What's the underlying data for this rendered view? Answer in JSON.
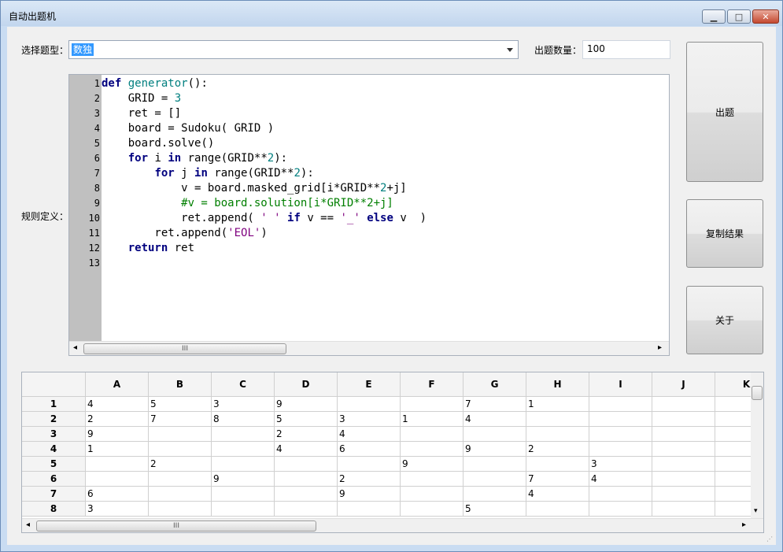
{
  "window": {
    "title": "自动出题机",
    "minimize": "▁",
    "maximize": "□",
    "close": "✕"
  },
  "labels": {
    "type": "选择题型：",
    "count": "出题数量：",
    "rules": "规则定义："
  },
  "type_select": {
    "value": "数独"
  },
  "count_input": {
    "value": "100"
  },
  "buttons": {
    "generate": "出题",
    "copy": "复制结果",
    "about": "关于"
  },
  "scroll": {
    "grip": "III",
    "left": "◂",
    "right": "▸",
    "up": "▴",
    "down": "▾"
  },
  "colors": {
    "keyword": "#00007f",
    "function": "#007f7f",
    "number": "#007f7f",
    "string": "#7f007f",
    "comment": "#007f00"
  },
  "code": {
    "line_numbers": [
      "1",
      "2",
      "3",
      "4",
      "5",
      "6",
      "7",
      "8",
      "9",
      "10",
      "11",
      "12",
      "13"
    ],
    "lines": [
      [
        {
          "t": "def",
          "c": "keyword"
        },
        {
          "t": " "
        },
        {
          "t": "generator",
          "c": "function"
        },
        {
          "t": "():"
        }
      ],
      [
        {
          "t": "    GRID = "
        },
        {
          "t": "3",
          "c": "number"
        }
      ],
      [
        {
          "t": "    ret = []"
        }
      ],
      [
        {
          "t": "    board = Sudoku( GRID )"
        }
      ],
      [
        {
          "t": "    board.solve()"
        }
      ],
      [
        {
          "t": "    "
        },
        {
          "t": "for",
          "c": "keyword"
        },
        {
          "t": " i "
        },
        {
          "t": "in",
          "c": "keyword"
        },
        {
          "t": " range(GRID**"
        },
        {
          "t": "2",
          "c": "number"
        },
        {
          "t": "):"
        }
      ],
      [
        {
          "t": "        "
        },
        {
          "t": "for",
          "c": "keyword"
        },
        {
          "t": " j "
        },
        {
          "t": "in",
          "c": "keyword"
        },
        {
          "t": " range(GRID**"
        },
        {
          "t": "2",
          "c": "number"
        },
        {
          "t": "):"
        }
      ],
      [
        {
          "t": "            v = board.masked_grid[i*GRID**"
        },
        {
          "t": "2",
          "c": "number"
        },
        {
          "t": "+j]"
        }
      ],
      [
        {
          "t": "            #v = board.solution[i*GRID**2+j]",
          "c": "comment"
        }
      ],
      [
        {
          "t": "            ret.append( "
        },
        {
          "t": "' '",
          "c": "string"
        },
        {
          "t": " "
        },
        {
          "t": "if",
          "c": "keyword"
        },
        {
          "t": " v == "
        },
        {
          "t": "'_'",
          "c": "string"
        },
        {
          "t": " "
        },
        {
          "t": "else",
          "c": "keyword"
        },
        {
          "t": " v  )"
        }
      ],
      [
        {
          "t": "        ret.append("
        },
        {
          "t": "'EOL'",
          "c": "string"
        },
        {
          "t": ")"
        }
      ],
      [
        {
          "t": "    "
        },
        {
          "t": "return",
          "c": "keyword"
        },
        {
          "t": " ret"
        }
      ],
      []
    ]
  },
  "table": {
    "columns": [
      "A",
      "B",
      "C",
      "D",
      "E",
      "F",
      "G",
      "H",
      "I",
      "J",
      "K"
    ],
    "rows": [
      {
        "label": "1",
        "cells": [
          "4",
          "5",
          "3",
          "9",
          "",
          "",
          "7",
          "1",
          "",
          "",
          ""
        ]
      },
      {
        "label": "2",
        "cells": [
          "2",
          "7",
          "8",
          "5",
          "3",
          "1",
          "4",
          "",
          "",
          "",
          ""
        ]
      },
      {
        "label": "3",
        "cells": [
          "9",
          "",
          "",
          "2",
          "4",
          "",
          "",
          "",
          "",
          "",
          ""
        ]
      },
      {
        "label": "4",
        "cells": [
          "1",
          "",
          "",
          "4",
          "6",
          "",
          "9",
          "2",
          "",
          "",
          ""
        ]
      },
      {
        "label": "5",
        "cells": [
          "",
          "2",
          "",
          "",
          "",
          "9",
          "",
          "",
          "3",
          "",
          ""
        ]
      },
      {
        "label": "6",
        "cells": [
          "",
          "",
          "9",
          "",
          "2",
          "",
          "",
          "7",
          "4",
          "",
          ""
        ]
      },
      {
        "label": "7",
        "cells": [
          "6",
          "",
          "",
          "",
          "9",
          "",
          "",
          "4",
          "",
          "",
          ""
        ]
      },
      {
        "label": "8",
        "cells": [
          "3",
          "",
          "",
          "",
          "",
          "",
          "5",
          "",
          "",
          "",
          ""
        ]
      }
    ]
  }
}
